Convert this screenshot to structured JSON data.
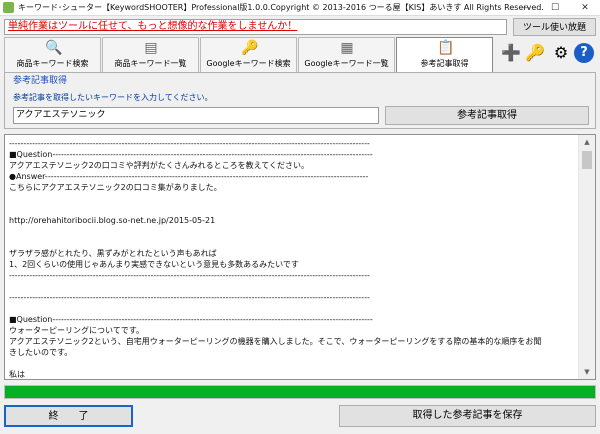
{
  "window": {
    "title": "キーワード･シューター【KeywordSHOOTER】Professional版1.0.0.Copyright © 2013-2016 つーる屋【KIS】あいきす All Rights Reserved.",
    "minimize_glyph": "—",
    "maximize_glyph": "☐",
    "close_glyph": "✕"
  },
  "ticker": {
    "text": "単純作業はツールに任せて、もっと想像的な作業をしませんか！"
  },
  "header": {
    "howto_button": "ツール使い放題"
  },
  "tabs": [
    {
      "label": "商品キーワード検索",
      "icon": "magnifier-icon",
      "glyph": "🔍"
    },
    {
      "label": "商品キーワード一覧",
      "icon": "card-icon",
      "glyph": "▤"
    },
    {
      "label": "Googleキーワード検索",
      "icon": "key-search-icon",
      "glyph": "🔑"
    },
    {
      "label": "Googleキーワード一覧",
      "icon": "grid-icon",
      "glyph": "▦"
    },
    {
      "label": "参考記事取得",
      "icon": "clipboard-icon",
      "glyph": "📋"
    }
  ],
  "tools": {
    "plus_glyph": "➕",
    "key_glyph": "🔑",
    "gear_glyph": "⚙",
    "help_glyph": "?"
  },
  "reference": {
    "group_title": "参考記事取得",
    "instruction": "参考記事を取得したいキーワードを入力してください。",
    "keyword_value": "アクアエステソニック",
    "get_button": "参考記事取得"
  },
  "articles": {
    "content": "-----------------------------------------------------------------------------------------------------------------------------\n■Question---------------------------------------------------------------------------------------------------------------\nアクアエステソニック2の口コミや評判がたくさんみれるところを教えてください。\n●Answer----------------------------------------------------------------------------------------------------------------\nこちらにアクアエステソニック2の口コミ集がありました。\n\n\nhttp://orehahitoribocii.blog.so-net.ne.jp/2015-05-21\n\n\nザラザラ感がとれたり、黒ずみがとれたという声もあれば\n1、2回くらいの使用じゃあんまり実感できないという意見も多数あるみたいです\n-----------------------------------------------------------------------------------------------------------------------------\n\n-----------------------------------------------------------------------------------------------------------------------------\n\n■Question---------------------------------------------------------------------------------------------------------------\nウォーターピーリングについてです。\nアクアエステソニック2という、自宅用ウォーターピーリングの機器を購入しました。そこで、ウォーターピーリングをする際の基本的な順序をお聞\nきしたいのです。\n\n私は\n化粧落とし→洗顔→ウォーターピーリング→化粧水、乳液"
  },
  "progress": {
    "value": 1.0,
    "fill_color": "#06b025"
  },
  "footer": {
    "exit_button": "終　　了",
    "save_button": "取得した参考記事を保存"
  },
  "scroll": {
    "up_glyph": "▲",
    "down_glyph": "▼"
  }
}
